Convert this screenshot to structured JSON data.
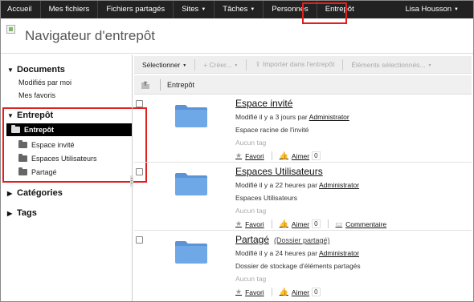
{
  "topnav": {
    "items": [
      {
        "label": "Accueil",
        "dropdown": false
      },
      {
        "label": "Mes fichiers",
        "dropdown": false
      },
      {
        "label": "Fichiers partagés",
        "dropdown": false
      },
      {
        "label": "Sites",
        "dropdown": true
      },
      {
        "label": "Tâches",
        "dropdown": true
      },
      {
        "label": "Personnes",
        "dropdown": false
      },
      {
        "label": "Entrepôt",
        "dropdown": false,
        "active": true
      }
    ],
    "user": "Lisa Housson",
    "highlight_color": "#e0201c"
  },
  "header": {
    "title": "Navigateur d'entrepôt"
  },
  "sidebar": {
    "documents": {
      "heading": "Documents",
      "links": [
        "Modifiés par moi",
        "Mes favoris"
      ]
    },
    "repository": {
      "heading": "Entrepôt",
      "root": "Entrepôt",
      "children": [
        "Espace invité",
        "Espaces Utilisateurs",
        "Partagé"
      ]
    },
    "categories": {
      "heading": "Catégories"
    },
    "tags": {
      "heading": "Tags"
    }
  },
  "toolbar": {
    "select": "Sélectionner",
    "create": "Créer...",
    "import": "Importer dans l'entrepôt",
    "selected_items": "Éléments sélectionnés..."
  },
  "breadcrumb": {
    "path": "Entrepôt"
  },
  "rows": [
    {
      "name": "Espace invité",
      "shared_tag": "",
      "modified_prefix": "Modifié il y a 3 jours par",
      "modified_by": "Administrator",
      "description": "Espace racine de l'invité",
      "tags": "Aucun tag",
      "favorite": "Favori",
      "like": "Aimer",
      "like_count": "0",
      "comment": ""
    },
    {
      "name": "Espaces Utilisateurs",
      "shared_tag": "",
      "modified_prefix": "Modifié il y a 22 heures par",
      "modified_by": "Administrator",
      "description": "Espaces Utilisateurs",
      "tags": "Aucun tag",
      "favorite": "Favori",
      "like": "Aimer",
      "like_count": "0",
      "comment": "Commentaire"
    },
    {
      "name": "Partagé",
      "shared_tag": "(Dossier partagé)",
      "modified_prefix": "Modifié il y a 24 heures par",
      "modified_by": "Administrator",
      "description": "Dossier de stockage d'éléments partagés",
      "tags": "Aucun tag",
      "favorite": "Favori",
      "like": "Aimer",
      "like_count": "0",
      "comment": ""
    }
  ],
  "colors": {
    "nav_bg": "#222222",
    "folder_blue": "#6fa8e6",
    "highlight_red": "#e0201c"
  }
}
